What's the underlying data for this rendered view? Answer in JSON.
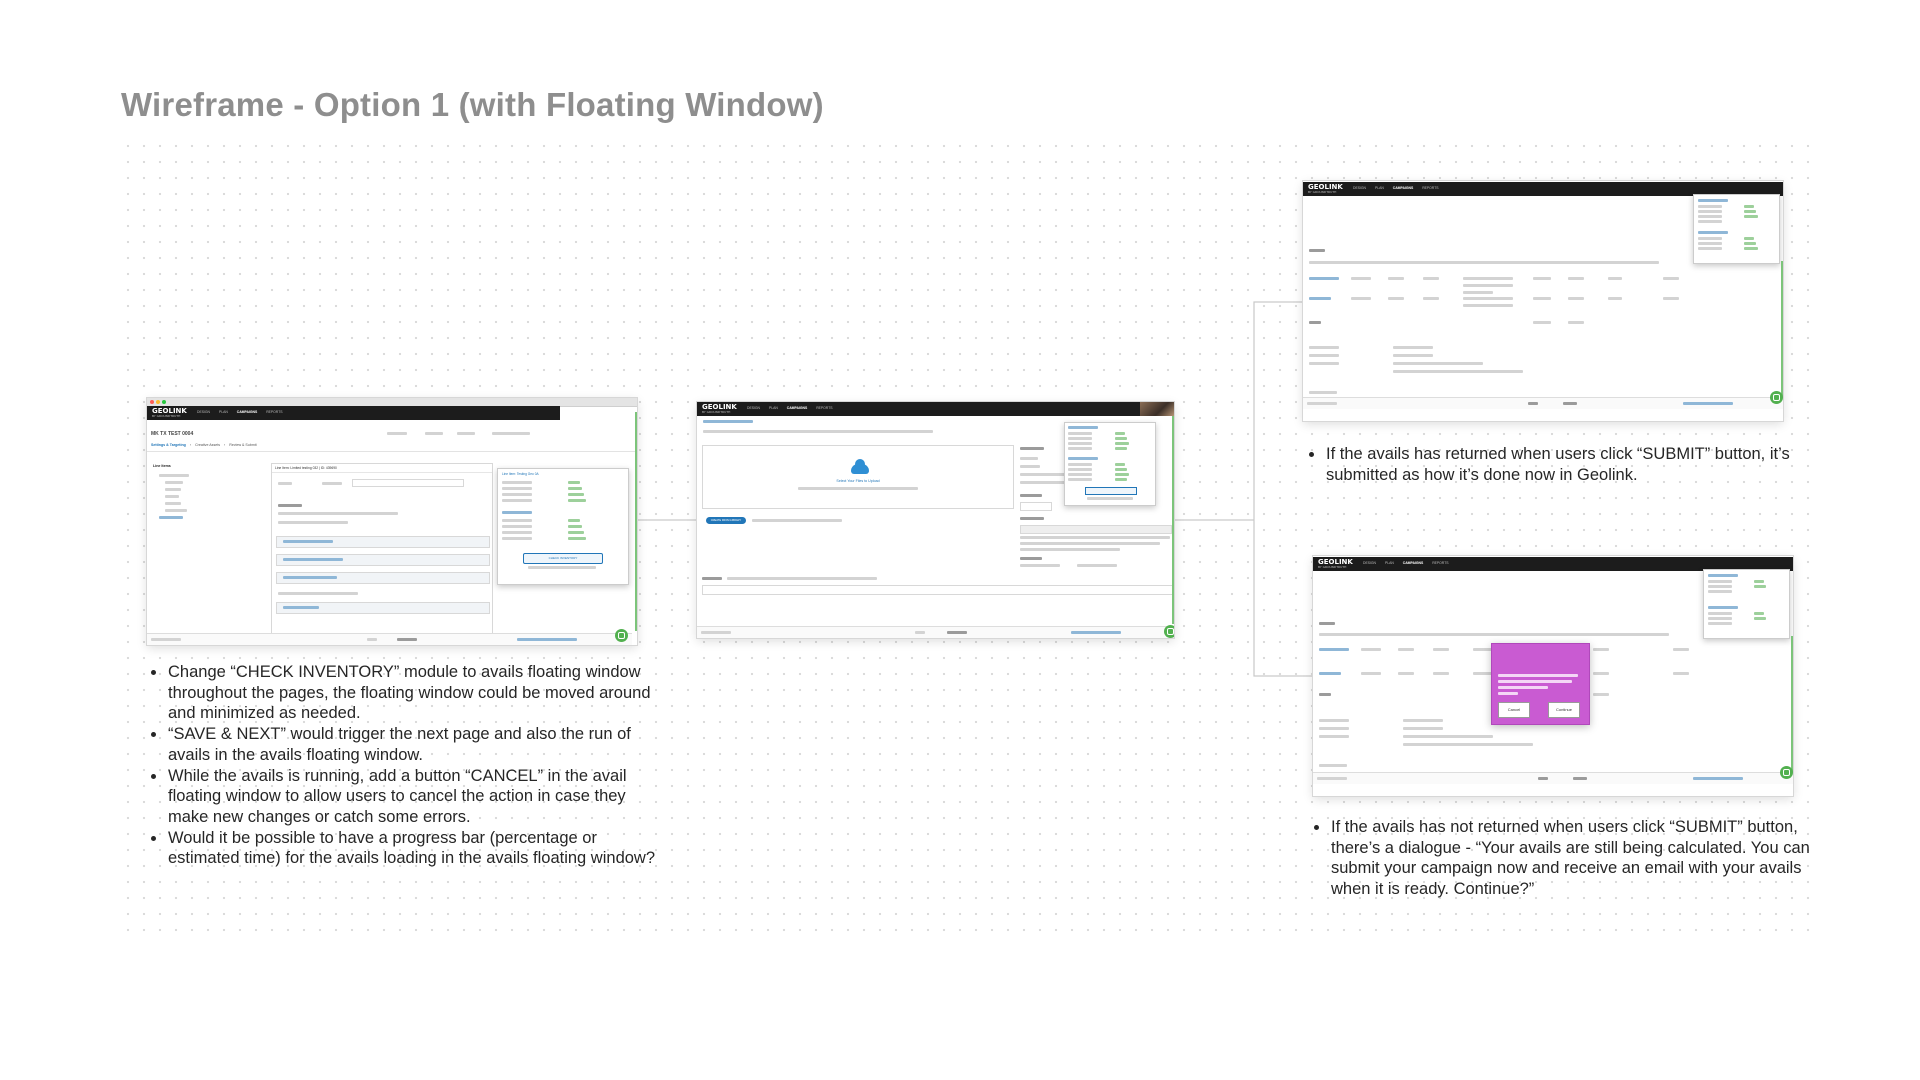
{
  "page": {
    "title": "Wireframe - Option 1 (with Floating Window)"
  },
  "app": {
    "brand": "GEOLINK",
    "brand_sub": "BY GROUNDTRUTH",
    "nav_items": [
      "DESIGN",
      "PLAN",
      "CAMPAIGNS",
      "REPORTS"
    ],
    "active_nav": "CAMPAIGNS",
    "accent_color": "#2176b8",
    "green_color": "#52b04f",
    "dialog_color": "#c95bd2"
  },
  "screen1": {
    "campaign_name": "MK TX TEST 0004",
    "step_settings": "Settings & Targeting",
    "step_creative": "Creative Assets",
    "step_review": "Review & Submit",
    "line_items_label": "Line Items",
    "line_item_title": "Line Item: Limited testing 032 | ID: 439690",
    "floating_title": "Line Item: Testing Geo 0A",
    "floating_button": "CHECK INVENTORY"
  },
  "screen2": {
    "upload_text": "Select Your Files to Upload",
    "create_button": "CREATE FROM LIBRARY"
  },
  "screen4": {
    "dialog_cancel": "Cancel",
    "dialog_continue": "Continue"
  },
  "notes": {
    "left": [
      "Change “CHECK INVENTORY” module to avails floating window throughout the pages, the floating window could be moved around and minimized as needed.",
      " “SAVE & NEXT” would trigger the next page and also the run of avails in the avails floating window.",
      "While the avails is running, add a button “CANCEL” in the avail floating window to allow users to cancel the action in case they make new changes or catch some errors.",
      "Would it be possible to have a progress bar (percentage or estimated time) for the avails loading in the avails floating window?"
    ],
    "top_right": [
      "If the avails has returned when users click “SUBMIT” button, it’s submitted as how it’s done now in Geolink."
    ],
    "bottom_right": [
      "If the avails has not returned when users click “SUBMIT” button, there’s a dialogue - “Your avails are still being calculated. You can submit your campaign now and receive an email with your avails when it is ready. Continue?”"
    ]
  }
}
